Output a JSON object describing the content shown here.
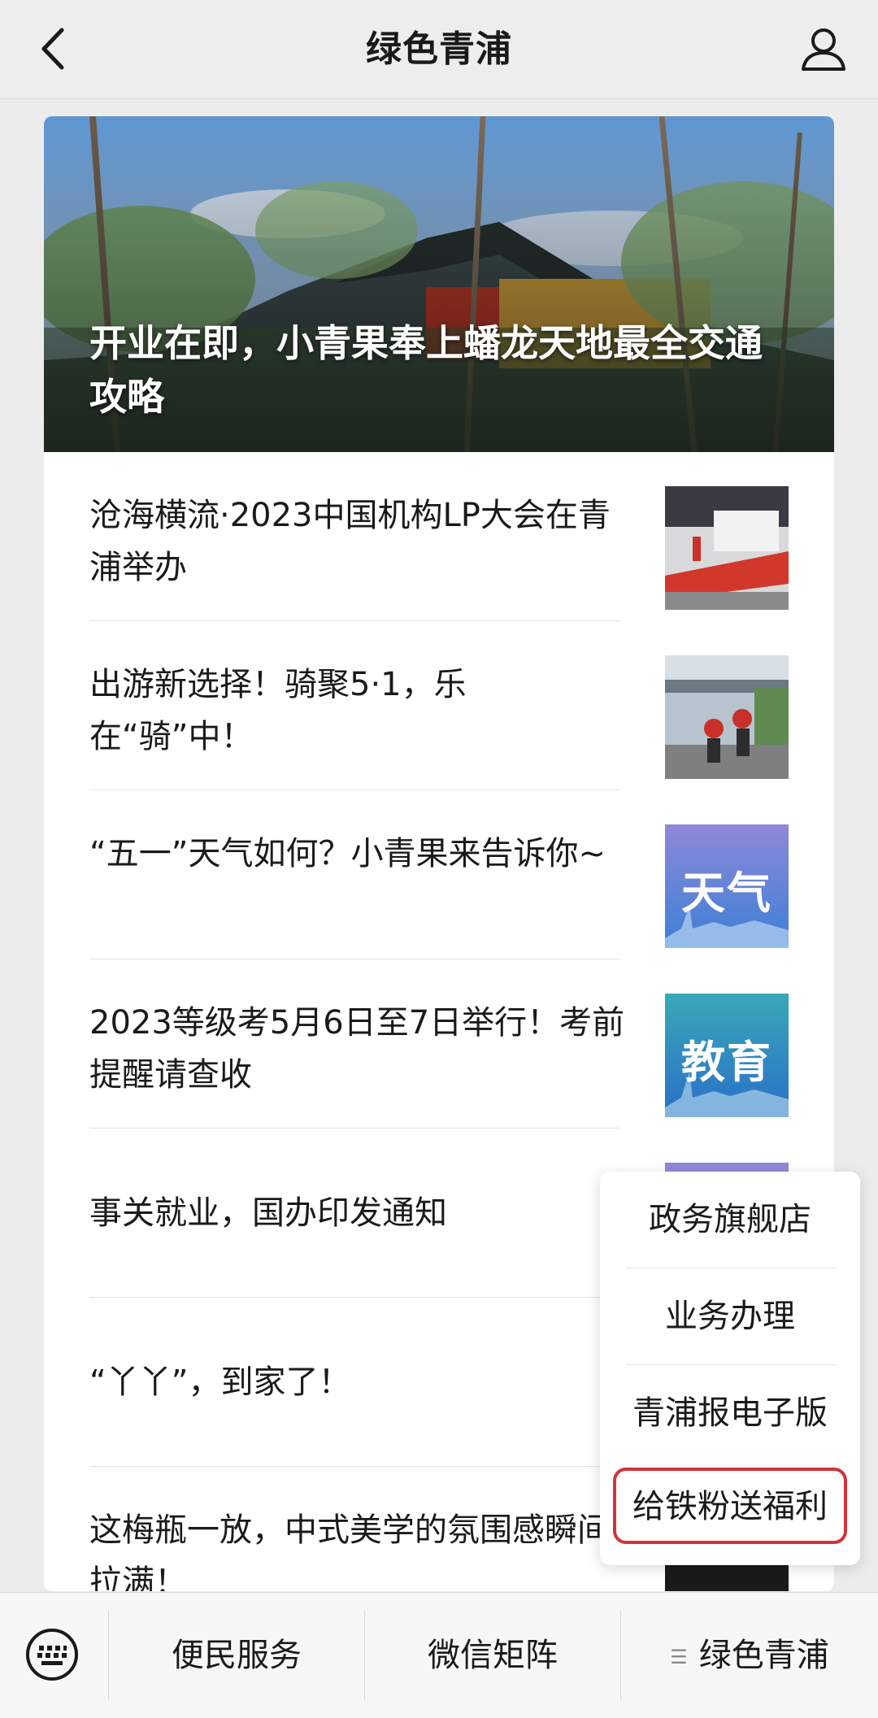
{
  "header": {
    "title": "绿色青浦",
    "back_icon": "chevron-left-icon",
    "profile_icon": "person-icon"
  },
  "hero": {
    "title": "开业在即，小青果奉上蟠龙天地最全交通攻略"
  },
  "articles": [
    {
      "title": "沧海横流·2023中国机构LP大会在青浦举办",
      "thumb_text": ""
    },
    {
      "title": "出游新选择！骑聚5·1，乐在“骑”中！",
      "thumb_text": ""
    },
    {
      "title": "“五一”天气如何？小青果来告诉你~",
      "thumb_text": "天气"
    },
    {
      "title": "2023等级考5月6日至7日举行！考前提醒请查收",
      "thumb_text": "教育"
    },
    {
      "title": "事关就业，国办印发通知",
      "thumb_text": ""
    },
    {
      "title": "“丫丫”，到家了！",
      "thumb_text": ""
    },
    {
      "title": "这梅瓶一放，中式美学的氛围感瞬间拉满！",
      "thumb_text": ""
    }
  ],
  "popup_menu": {
    "items": [
      "政务旗舰店",
      "业务办理",
      "青浦报电子版",
      "给铁粉送福利"
    ],
    "highlight_color": "#d0343a"
  },
  "bottom_menu": {
    "keyboard_icon": "keyboard-icon",
    "tabs": [
      "便民服务",
      "微信矩阵",
      "绿色青浦"
    ]
  }
}
